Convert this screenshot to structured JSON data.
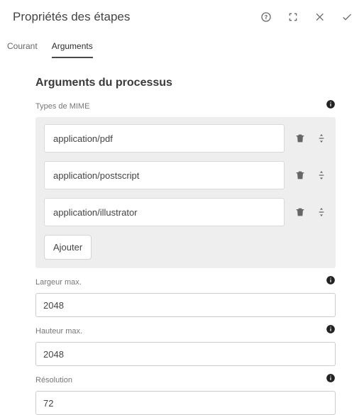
{
  "header": {
    "title": "Propriétés des étapes"
  },
  "tabs": {
    "current": "Courant",
    "arguments": "Arguments"
  },
  "section_title": "Arguments du processus",
  "mime": {
    "label": "Types de MIME",
    "items": [
      "application/pdf",
      "application/postscript",
      "application/illustrator"
    ],
    "add_label": "Ajouter"
  },
  "width": {
    "label": "Largeur max.",
    "value": "2048"
  },
  "height": {
    "label": "Hauteur max.",
    "value": "2048"
  },
  "resolution": {
    "label": "Résolution",
    "value": "72"
  }
}
